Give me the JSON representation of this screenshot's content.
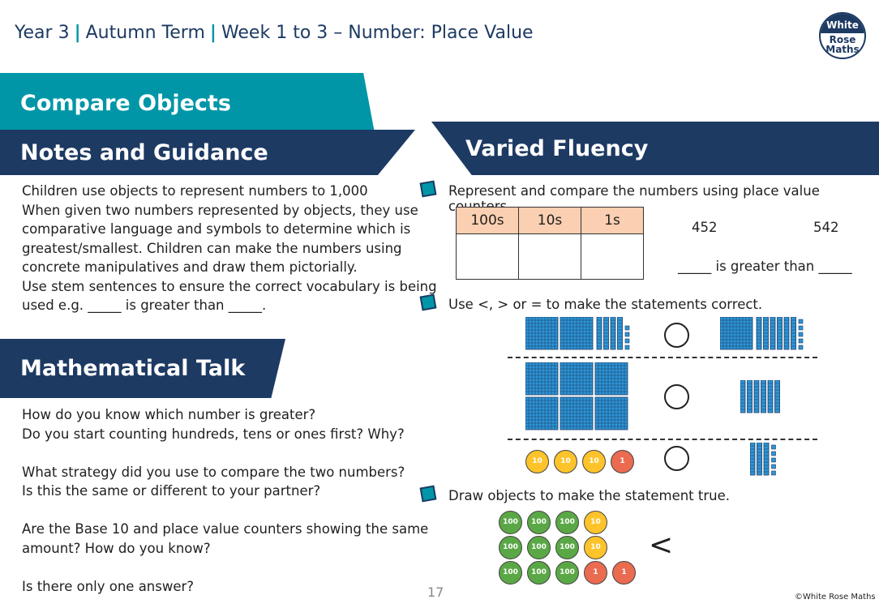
{
  "header": {
    "year": "Year 3",
    "term": "Autumn Term",
    "week": "Week 1 to 3 – Number: Place Value",
    "separator": "|"
  },
  "logo": {
    "line1": "White",
    "line2": "Rose",
    "line3": "Maths"
  },
  "title": "Compare Objects",
  "notes": {
    "heading": "Notes and Guidance",
    "lines": [
      "Children use objects to represent numbers to 1,000",
      "When given two numbers represented by objects, they use",
      "comparative language and symbols to determine which is",
      "greatest/smallest. Children can make the numbers using",
      "concrete manipulatives and draw them pictorially.",
      "Use stem sentences to ensure the correct vocabulary is being",
      "used e.g. _____ is greater than _____."
    ]
  },
  "talk": {
    "heading": "Mathematical Talk",
    "lines": [
      "How do you know which number is greater?",
      "Do you start counting hundreds, tens or ones first? Why?",
      "",
      "What strategy did you use to compare the two numbers?",
      "Is this the same or different to your partner?",
      "",
      "Are the Base 10 and place value counters showing the same",
      "amount? How do you know?",
      "",
      "Is there only one answer?"
    ]
  },
  "fluency": {
    "heading": "Varied Fluency",
    "q1": {
      "text": "Represent and compare the numbers using place value counters.",
      "columns": [
        "100s",
        "10s",
        "1s"
      ],
      "n1": "452",
      "n2": "542",
      "stem": "_____ is greater than _____"
    },
    "q2": {
      "text": "Use <, > or = to make the statements correct.",
      "rows": [
        {
          "left": {
            "hundreds": 2,
            "tens": 4,
            "ones": 4
          },
          "right": {
            "hundreds": 1,
            "tens": 6,
            "ones": 5
          }
        },
        {
          "left": {
            "hundreds": 6,
            "tens": 0,
            "ones": 0
          },
          "right": {
            "hundreds": 0,
            "tens": 6,
            "ones": 0
          }
        },
        {
          "left_counters": [
            "10",
            "10",
            "10",
            "1"
          ],
          "right": {
            "hundreds": 0,
            "tens": 3,
            "ones": 5
          }
        }
      ]
    },
    "q3": {
      "text": "Draw objects to make the statement true.",
      "counters": [
        [
          "100",
          "100",
          "100",
          "10"
        ],
        [
          "100",
          "100",
          "100",
          "10"
        ],
        [
          "100",
          "100",
          "100",
          "1",
          "1"
        ]
      ],
      "symbol": "<"
    }
  },
  "colors": {
    "teal": "#0096a7",
    "navy": "#1d3a63",
    "hundred": "#5aa845",
    "ten": "#fdc32a",
    "one": "#ea6b50",
    "base10": "#2d95d6"
  },
  "page_number": "17",
  "copyright": "©White Rose Maths"
}
